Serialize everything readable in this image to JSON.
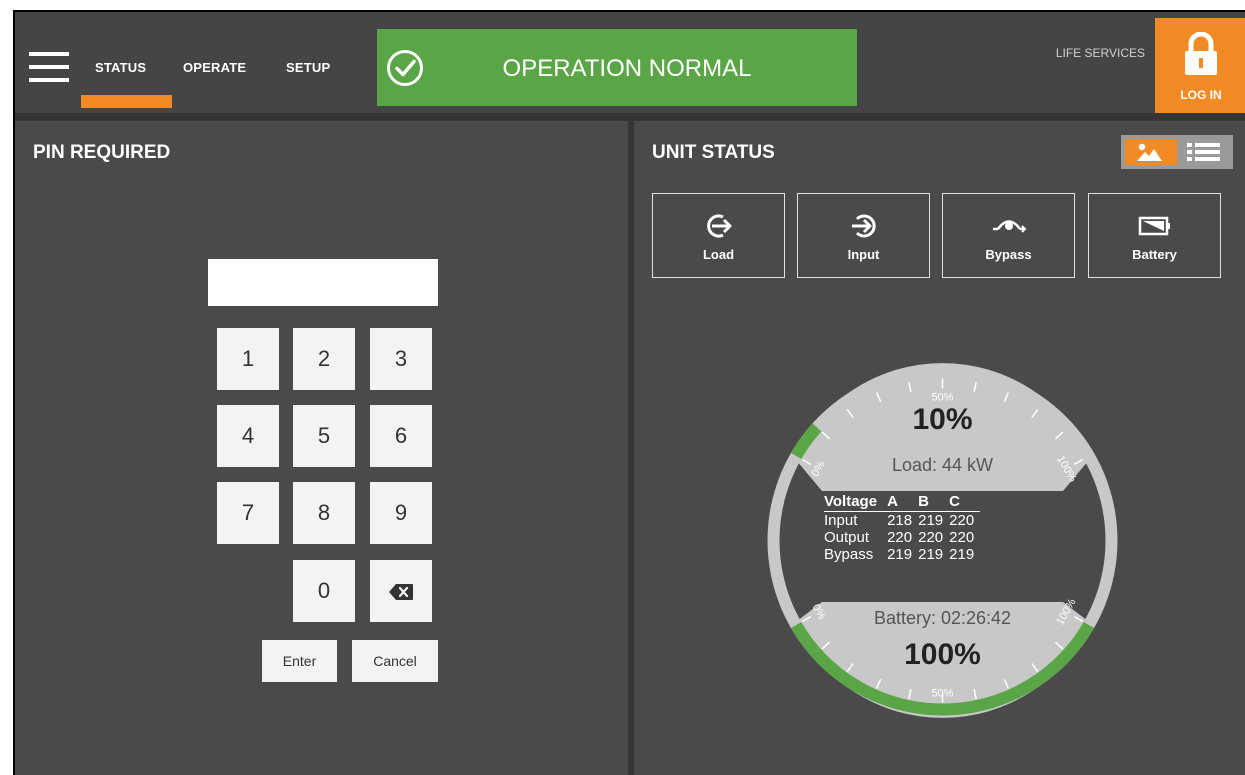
{
  "header": {
    "tabs": [
      {
        "label": "STATUS",
        "active": true
      },
      {
        "label": "OPERATE",
        "active": false
      },
      {
        "label": "SETUP",
        "active": false
      }
    ],
    "status_text": "OPERATION NORMAL",
    "life_services": "LIFE SERVICES",
    "login_label": "LOG IN"
  },
  "left_panel": {
    "title": "PIN REQUIRED",
    "pin_value": "",
    "keys": [
      "1",
      "2",
      "3",
      "4",
      "5",
      "6",
      "7",
      "8",
      "9",
      "0"
    ],
    "enter_label": "Enter",
    "cancel_label": "Cancel"
  },
  "right_panel": {
    "title": "UNIT STATUS",
    "tiles": [
      {
        "label": "Load",
        "icon": "load-icon"
      },
      {
        "label": "Input",
        "icon": "input-icon"
      },
      {
        "label": "Bypass",
        "icon": "bypass-icon"
      },
      {
        "label": "Battery",
        "icon": "battery-icon"
      }
    ],
    "gauge": {
      "load_percent": "10%",
      "load_text": "Load: 44 kW",
      "battery_text": "Battery: 02:26:42",
      "battery_percent": "100%",
      "load_fraction": 0.1,
      "battery_fraction": 1.0,
      "scale_labels": {
        "zero": "0%",
        "half": "50%",
        "full": "100%"
      }
    },
    "voltage_table": {
      "headers": [
        "Voltage",
        "A",
        "B",
        "C"
      ],
      "rows": [
        {
          "label": "Input",
          "values": [
            "218",
            "219",
            "220"
          ]
        },
        {
          "label": "Output",
          "values": [
            "220",
            "220",
            "220"
          ]
        },
        {
          "label": "Bypass",
          "values": [
            "219",
            "219",
            "219"
          ]
        }
      ]
    }
  },
  "colors": {
    "accent_orange": "#f28b25",
    "status_green": "#5aa646",
    "panel_bg": "#4a4a4a"
  }
}
